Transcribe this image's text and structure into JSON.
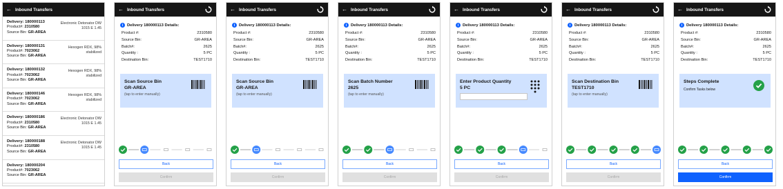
{
  "app": {
    "header_title": "Inbound Transfers"
  },
  "list": {
    "items": [
      {
        "delivery": "Delivery: 180000113",
        "product_label": "Product#: ",
        "product": "2310580",
        "bin_label": "Source Bin: ",
        "bin": "GR-AREA",
        "desc": "Electronic Detonator DW 1015 E 1.45"
      },
      {
        "delivery": "Delivery: 180000131",
        "product_label": "Product#: ",
        "product": "7023062",
        "bin_label": "Source Bin: ",
        "bin": "GR-AREA",
        "desc": "Hexogen RDX, 98% stabilized"
      },
      {
        "delivery": "Delivery: 180000132",
        "product_label": "Product#: ",
        "product": "7023062",
        "bin_label": "Source Bin: ",
        "bin": "GR-AREA",
        "desc": "Hexogen RDX, 98% stabilized"
      },
      {
        "delivery": "Delivery: 180000146",
        "product_label": "Product#: ",
        "product": "7023062",
        "bin_label": "Source Bin: ",
        "bin": "GR-AREA",
        "desc": "Hexogen RDX, 98% stabilized"
      },
      {
        "delivery": "Delivery: 180000186",
        "product_label": "Product#: ",
        "product": "2310580",
        "bin_label": "Source Bin: ",
        "bin": "GR-AREA",
        "desc": "Electronic Detonator DW 1015 E 1.45"
      },
      {
        "delivery": "Delivery: 180000188",
        "product_label": "Product#: ",
        "product": "2310580",
        "bin_label": "Source Bin: ",
        "bin": "GR-AREA",
        "desc": "Electronic Detonator DW 1015 E 1.45"
      },
      {
        "delivery": "Delivery: 180000204",
        "product_label": "Product#: ",
        "product": "7023062",
        "bin_label": "Source Bin: ",
        "bin": "GR-AREA",
        "desc": ""
      }
    ]
  },
  "details": {
    "title": "Delivery 180000113 Details:",
    "rows": [
      {
        "label": "Product #:",
        "value": "2310580"
      },
      {
        "label": "Source Bin:",
        "value": "GR-AREA"
      },
      {
        "label": "Batch#:",
        "value": "2625"
      },
      {
        "label": "Quantity :",
        "value": "5 PC"
      },
      {
        "label": "Destination Bin:",
        "value": "TEST1710"
      }
    ]
  },
  "screens": [
    {
      "card_title": "Scan Source Bin",
      "card_value": "GR-AREA",
      "card_hint": "(tap to enter manually)",
      "icon": "barcode-icon",
      "completed": 1,
      "current": 1,
      "confirm_label": "Confirm",
      "confirm_active": false
    },
    {
      "card_title": "Scan Source Bin",
      "card_value": "GR-AREA",
      "card_hint": "(tap to enter manually)",
      "icon": "barcode-icon",
      "completed": 1,
      "current": 1,
      "confirm_label": "Confirm",
      "confirm_active": false
    },
    {
      "card_title": "Scan Batch Number",
      "card_value": "2625",
      "card_hint": "(tap to enter manually)",
      "icon": "barcode-icon",
      "completed": 2,
      "current": 2,
      "confirm_label": "Confirm",
      "confirm_active": false
    },
    {
      "card_title": "Enter Product Quantity",
      "card_value": "5 PC",
      "card_hint": "",
      "icon": "keypad-icon",
      "completed": 3,
      "current": 3,
      "confirm_label": "Confirm",
      "confirm_active": false
    },
    {
      "card_title": "Scan Destination Bin",
      "card_value": "TEST1710",
      "card_hint": "(tap to enter manually)",
      "icon": "barcode-icon",
      "completed": 4,
      "current": 4,
      "confirm_label": "Confirm",
      "confirm_active": false
    },
    {
      "card_title": "Steps Complete",
      "card_value": "Confirm Tasks below",
      "card_hint": "",
      "icon": "check-circle-icon",
      "completed": 5,
      "current": -1,
      "confirm_label": "Confirm",
      "confirm_active": true
    }
  ],
  "buttons": {
    "back_label": "Back"
  },
  "colors": {
    "done": "#24a148",
    "current": "#4589ff",
    "pending": "#c6c6c6",
    "card": "#d0e2ff",
    "primary": "#0f62fe"
  }
}
